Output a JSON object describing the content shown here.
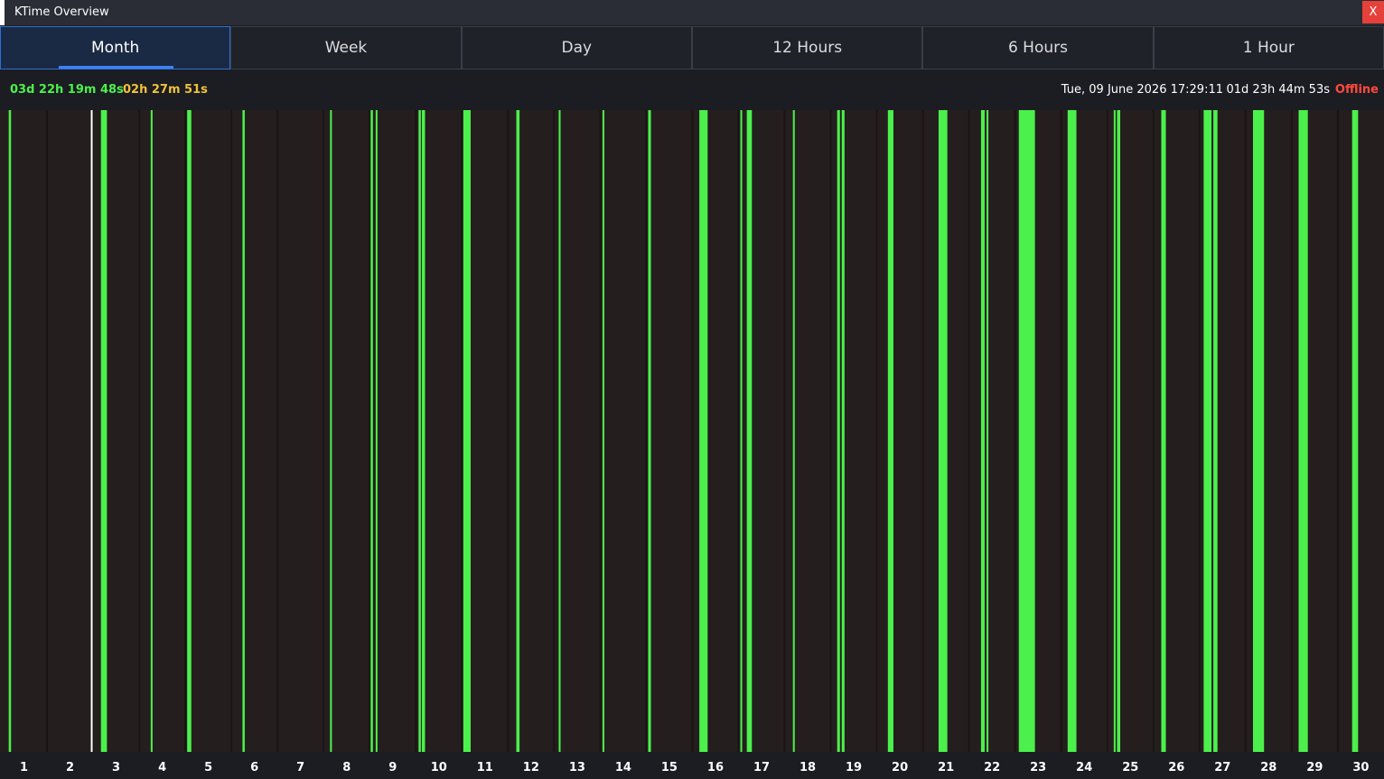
{
  "window": {
    "title": "KTime Overview",
    "close_label": "X"
  },
  "tabs": [
    {
      "label": "Month",
      "active": true
    },
    {
      "label": "Week",
      "active": false
    },
    {
      "label": "Day",
      "active": false
    },
    {
      "label": "12 Hours",
      "active": false
    },
    {
      "label": "6 Hours",
      "active": false
    },
    {
      "label": "1 Hour",
      "active": false
    }
  ],
  "info": {
    "uptime": "03d 22h 19m 48s",
    "idle": "02h 27m 51s",
    "datetime": "Tue, 09 June 2026 17:29:11",
    "session": "01d 23h 44m 53s",
    "status": "Offline"
  },
  "colors": {
    "active": "#4cf04c",
    "background": "#251e1e",
    "cursor": "#ffffff",
    "idle": "#f0c23a",
    "offline": "#ff4a3d",
    "accent": "#3b82f6"
  },
  "chart_data": {
    "type": "bar",
    "categories": [
      "1",
      "2",
      "3",
      "4",
      "5",
      "6",
      "7",
      "8",
      "9",
      "10",
      "11",
      "12",
      "13",
      "14",
      "15",
      "16",
      "17",
      "18",
      "19",
      "20",
      "21",
      "22",
      "23",
      "24",
      "25",
      "26",
      "27",
      "28",
      "29",
      "30"
    ],
    "x_unit": "day of month",
    "xlim": [
      0,
      30
    ],
    "current_time": 1.97,
    "active_intervals": [
      [
        0.17,
        0.22
      ],
      [
        2.17,
        2.3
      ],
      [
        3.25,
        3.29
      ],
      [
        4.04,
        4.13
      ],
      [
        5.24,
        5.29
      ],
      [
        7.14,
        7.18
      ],
      [
        8.02,
        8.07
      ],
      [
        8.13,
        8.15
      ],
      [
        9.06,
        9.11
      ],
      [
        9.13,
        9.2
      ],
      [
        10.03,
        10.19
      ],
      [
        11.18,
        11.25
      ],
      [
        12.1,
        12.14
      ],
      [
        13.05,
        13.08
      ],
      [
        14.04,
        14.1
      ],
      [
        15.15,
        15.33
      ],
      [
        16.04,
        16.07
      ],
      [
        16.18,
        16.29
      ],
      [
        17.18,
        17.22
      ],
      [
        18.14,
        18.2
      ],
      [
        18.24,
        18.3
      ],
      [
        19.24,
        19.36
      ],
      [
        20.34,
        20.53
      ],
      [
        21.26,
        21.34
      ],
      [
        21.38,
        21.42
      ],
      [
        22.08,
        22.43
      ],
      [
        23.14,
        23.33
      ],
      [
        24.14,
        24.18
      ],
      [
        24.21,
        24.28
      ],
      [
        25.17,
        25.27
      ],
      [
        26.09,
        26.26
      ],
      [
        26.3,
        26.39
      ],
      [
        27.16,
        27.4
      ],
      [
        28.15,
        28.35
      ],
      [
        29.31,
        29.44
      ]
    ]
  }
}
